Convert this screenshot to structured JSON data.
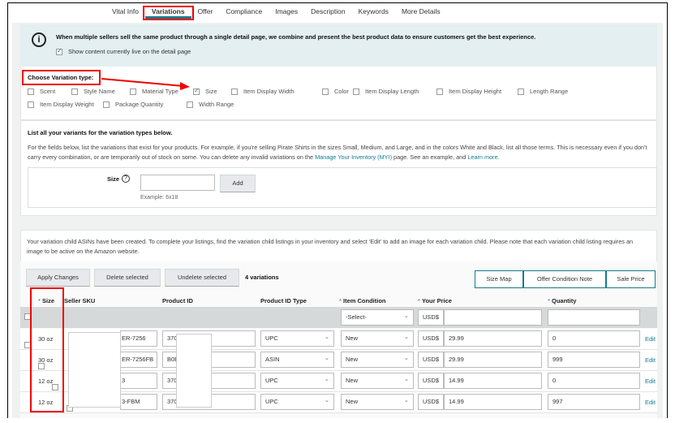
{
  "tabs": [
    "Vital Info",
    "Variations",
    "Offer",
    "Compliance",
    "Images",
    "Description",
    "Keywords",
    "More Details"
  ],
  "active_tab": "Variations",
  "info": {
    "text": "When multiple sellers sell the same product through a single detail page, we combine and present the best product data to ensure customers get the best experience.",
    "checkbox_label": "Show content currently live on the detail page",
    "checked": true
  },
  "variation_type": {
    "heading": "Choose Variation type:",
    "options": [
      {
        "label": "Scent",
        "checked": false
      },
      {
        "label": "Style Name",
        "checked": false
      },
      {
        "label": "Material Type",
        "checked": false
      },
      {
        "label": "Size",
        "checked": true
      },
      {
        "label": "Item Display Width",
        "checked": false
      },
      {
        "label": "Color",
        "checked": false
      },
      {
        "label": "Item Display Length",
        "checked": false
      },
      {
        "label": "Item Display Height",
        "checked": false
      },
      {
        "label": "Length Range",
        "checked": false
      },
      {
        "label": "Item Display Weight",
        "checked": false
      },
      {
        "label": "Package Quantity",
        "checked": false
      },
      {
        "label": "Width Range",
        "checked": false
      }
    ]
  },
  "variants": {
    "heading": "List all your variants for the variation types below.",
    "desc_1": "For the fields below, list the variations that exist for your products. For example, if you're selling Pirate Shirts in the sizes Small, Medium, and Large, and in the colors White and Black, list all those terms. This is necessary even if you don't carry every combination, or are temporarily out of stock on some. You can delete any invalid variations on the ",
    "link_myi": "Manage Your Inventory (MYI)",
    "desc_2": " page. See an example, and ",
    "link_learn": "Learn more.",
    "size_label": "Size",
    "size_value": "",
    "add_label": "Add",
    "example": "Example: 6x18"
  },
  "children": {
    "notice": "Your variation child ASINs have been created. To complete your listings, find the variation child listings in your inventory and select 'Edit' to add an image for each variation child. Please note that each variation child listing requires an image to be active on the Amazon website.",
    "apply": "Apply Changes",
    "delete": "Delete selected",
    "undelete": "Undelete selected",
    "count": "4 variations",
    "size_map": "Size Map",
    "offer_note": "Offer Condition Note",
    "sale_price": "Sale Price",
    "headers": {
      "size": "Size",
      "sku": "Seller SKU",
      "pid": "Product ID",
      "pidtype": "Product ID Type",
      "condition": "Item Condition",
      "price": "Your Price",
      "qty": "Quantity"
    },
    "bulk": {
      "condition": "-Select-",
      "currency": "USD$",
      "price": "",
      "qty": ""
    },
    "edit": "Edit",
    "rows": [
      {
        "size": "30 oz",
        "sku": "ER-7256",
        "pid": "370",
        "pidtype": "UPC",
        "condition": "New",
        "currency": "USD$",
        "price": "29.99",
        "qty": "0"
      },
      {
        "size": "30 oz",
        "sku": "ER-7256FB",
        "pid": "B0E",
        "pidtype": "ASIN",
        "condition": "New",
        "currency": "USD$",
        "price": "29.99",
        "qty": "999"
      },
      {
        "size": "12 oz",
        "sku": "3",
        "pid": "370",
        "pidtype": "UPC",
        "condition": "New",
        "currency": "USD$",
        "price": "14.99",
        "qty": "0"
      },
      {
        "size": "12 oz",
        "sku": "3-FBM",
        "pid": "370",
        "pidtype": "UPC",
        "condition": "New",
        "currency": "USD$",
        "price": "14.99",
        "qty": "997"
      }
    ]
  },
  "colors": {
    "accent": "#137b8a",
    "highlight": "#e00000",
    "info_bg": "#e3eff0"
  }
}
